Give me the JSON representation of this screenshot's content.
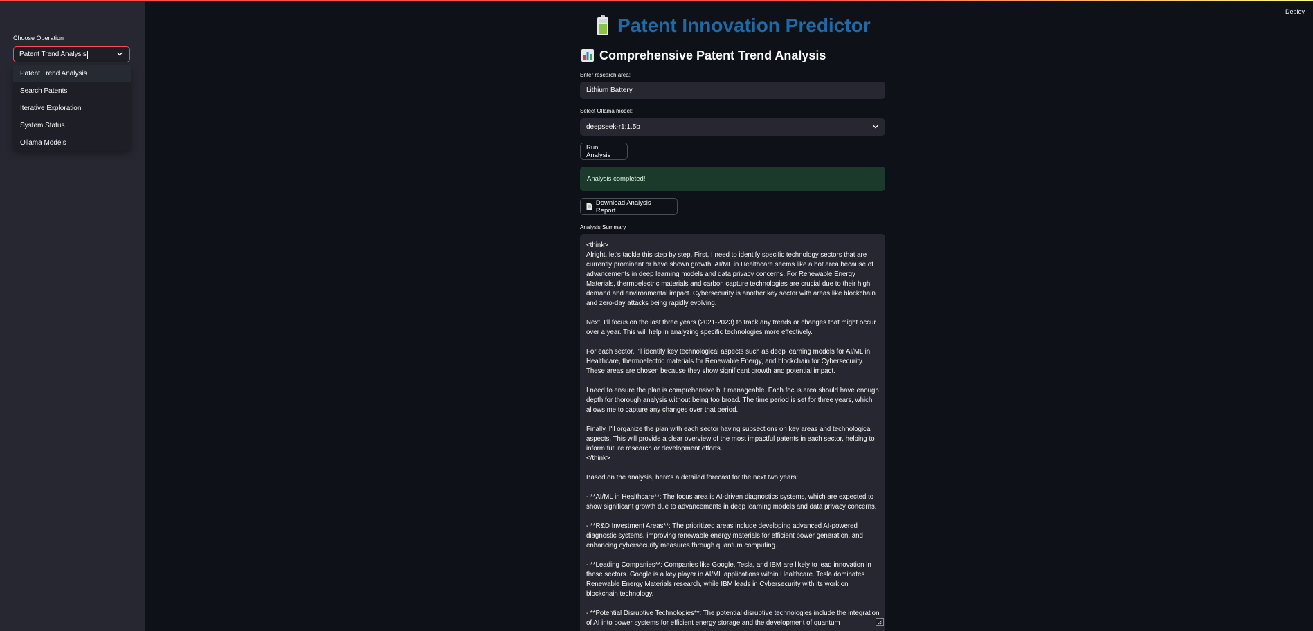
{
  "deploy_label": "Deploy",
  "sidebar": {
    "label": "Choose Operation",
    "selected": "Patent Trend Analysis",
    "options": [
      "Patent Trend Analysis",
      "Search Patents",
      "Iterative Exploration",
      "System Status",
      "Ollama Models"
    ]
  },
  "main": {
    "title": "Patent Innovation Predictor",
    "title_icon": "battery-icon",
    "subtitle": "Comprehensive Patent Trend Analysis",
    "subtitle_icon": "bar-chart-icon",
    "research_label": "Enter research area:",
    "research_value": "Lithium Battery",
    "model_label": "Select Ollama model:",
    "model_value": "deepseek-r1:1.5b",
    "run_button": "Run Analysis",
    "success_message": "Analysis completed!",
    "download_button": "Download Analysis Report",
    "download_icon": "document-icon",
    "summary_label": "Analysis Summary",
    "summary_paragraphs": [
      "<think>\nAlright, let's tackle this step by step. First, I need to identify specific technology sectors that are currently prominent or have shown growth. AI/ML in Healthcare seems like a hot area because of advancements in deep learning models and data privacy concerns. For Renewable Energy Materials, thermoelectric materials and carbon capture technologies are crucial due to their high demand and environmental impact. Cybersecurity is another key sector with areas like blockchain and zero-day attacks being rapidly evolving.",
      "Next, I'll focus on the last three years (2021-2023) to track any trends or changes that might occur over a year. This will help in analyzing specific technologies more effectively.",
      "For each sector, I'll identify key technological aspects such as deep learning models for AI/ML in Healthcare, thermoelectric materials for Renewable Energy, and blockchain for Cybersecurity. These areas are chosen because they show significant growth and potential impact.",
      "I need to ensure the plan is comprehensive but manageable. Each focus area should have enough depth for thorough analysis without being too broad. The time period is set for three years, which allows me to capture any changes over that period.",
      "Finally, I'll organize the plan with each sector having subsections on key areas and technological aspects. This will provide a clear overview of the most impactful patents in each sector, helping to inform future research or development efforts.\n</think>",
      "Based on the analysis, here's a detailed forecast for the next two years:",
      "- **AI/ML in Healthcare**: The focus area is AI-driven diagnostics systems, which are expected to show significant growth due to advancements in deep learning models and data privacy concerns.",
      "- **R&D Investment Areas**: The prioritized areas include developing advanced AI-powered diagnostic systems, improving renewable energy materials for efficient power generation, and enhancing cybersecurity measures through quantum computing.",
      "- **Leading Companies**: Companies like Google, Tesla, and IBM are likely to lead innovation in these sectors. Google is a key player in AI/ML applications within Healthcare. Tesla dominates Renewable Energy Materials research, while IBM leads in Cybersecurity with its work on blockchain technology.",
      "- **Potential Disruptive Technologies**: The potential disruptive technologies include the integration of AI into power systems for efficient energy storage and the development of quantum"
    ]
  },
  "colors": {
    "accent": "#ff4b4b",
    "title": "#1c6aa8",
    "success_bg": "#1b3a2b",
    "sidebar_bg": "#262730",
    "page_bg": "#0e1117"
  }
}
